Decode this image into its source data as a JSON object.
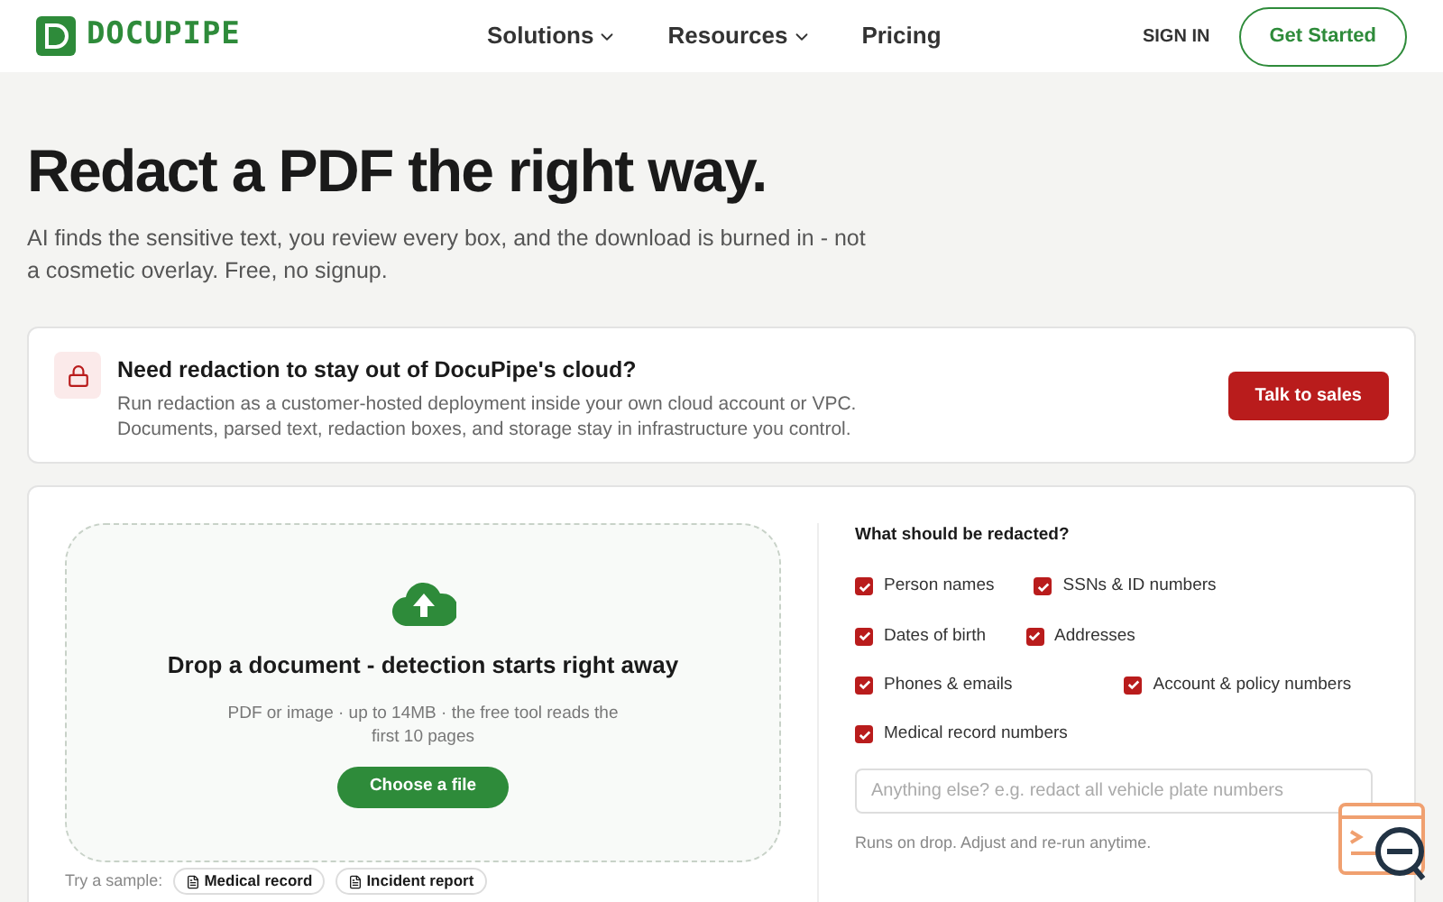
{
  "header": {
    "logo": "DOCUPIPE",
    "nav": [
      {
        "label": "Solutions",
        "dropdown": true
      },
      {
        "label": "Resources",
        "dropdown": true
      },
      {
        "label": "Pricing",
        "dropdown": false
      }
    ],
    "sign_in": "SIGN IN",
    "cta": "Get Started"
  },
  "hero": {
    "title": "Redact a PDF the right way.",
    "subtitle": "AI finds the sensitive text, you review every box, and the download is burned in - not a cosmetic overlay. Free, no signup."
  },
  "notice": {
    "title": "Need redaction to stay out of DocuPipe's cloud?",
    "text": "Run redaction as a customer-hosted deployment inside your own cloud account or VPC. Documents, parsed text, redaction boxes, and storage stay in infrastructure you control.",
    "button": "Talk to sales"
  },
  "dropzone": {
    "title": "Drop a document - detection starts right away",
    "hint": "PDF or image · up to 14MB · the free tool reads the first 10 pages",
    "button": "Choose a file"
  },
  "samples": {
    "label": "Try a sample:",
    "items": [
      "Medical record",
      "Incident report"
    ]
  },
  "options": {
    "title": "What should be redacted?",
    "items": [
      {
        "label": "Person names",
        "checked": true
      },
      {
        "label": "SSNs & ID numbers",
        "checked": true
      },
      {
        "label": "Dates of birth",
        "checked": true
      },
      {
        "label": "Addresses",
        "checked": true
      },
      {
        "label": "Phones & emails",
        "checked": true
      },
      {
        "label": "Account & policy numbers",
        "checked": true
      },
      {
        "label": "Medical record numbers",
        "checked": true
      }
    ],
    "placeholder": "Anything else? e.g. redact all vehicle plate numbers",
    "note": "Runs on drop. Adjust and re-run anytime."
  }
}
